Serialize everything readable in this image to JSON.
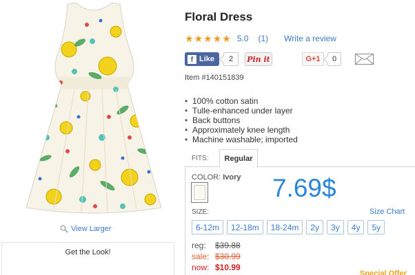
{
  "product": {
    "title": "Floral Dress",
    "rating_value": "5.0",
    "rating_count": "(1)",
    "write_review": "Write a review",
    "item_number": "Item #140151839",
    "view_larger": "View Larger",
    "get_the_look": "Get the Look!"
  },
  "social": {
    "fb_label": "Like",
    "fb_count": "2",
    "pinit_label": "Pin it",
    "gplus_label": "G+1",
    "gplus_count": "0"
  },
  "features": [
    "100% cotton satin",
    "Tulle-enhanced under layer",
    "Back buttons",
    "Approximately knee length",
    "Machine washable; imported"
  ],
  "fits": {
    "label": "FITS:",
    "selected": "Regular"
  },
  "color": {
    "label": "COLOR:",
    "value": "Ivory",
    "swatch_hex": "#fbf8ef"
  },
  "price_display": "7.69$",
  "size": {
    "label": "SIZE:",
    "chart_link": "Size Chart",
    "options": [
      "6-12m",
      "12-18m",
      "18-24m",
      "2y",
      "3y",
      "4y",
      "5y"
    ]
  },
  "pricing": {
    "reg_label": "reg:",
    "reg_value": "$39.88",
    "sale_label": "sale:",
    "sale_value": "$30.99",
    "now_label": "now:",
    "now_value": "$10.99"
  },
  "cut_off_text": "Special Offer",
  "colors": {
    "link": "#3d7cc9",
    "star": "#f19a1f",
    "price_blue": "#2a86d8",
    "now_red": "#cc1f1f",
    "sale_orange": "#e05a2b"
  },
  "icons": [
    "magnifier-icon",
    "facebook-icon",
    "pinterest-icon",
    "google-plus-icon",
    "mail-icon",
    "star-icon"
  ]
}
